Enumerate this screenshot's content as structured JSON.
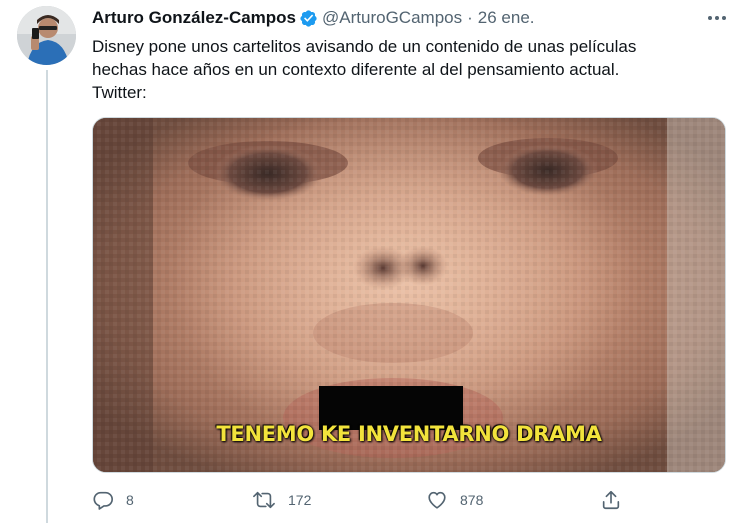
{
  "tweet": {
    "author_name": "Arturo González-Campos",
    "handle": "@ArturoGCampos",
    "separator": "·",
    "date": "26 ene.",
    "verified": true,
    "text_lines": [
      "Disney pone unos cartelitos avisando de un contenido de unas películas",
      "hechas hace años en un contexto diferente al del pensamiento actual.",
      "Twitter:"
    ],
    "media": {
      "caption": "TENEMO KE INVENTARNO DRAMA",
      "caption_color": "#f2e33c"
    },
    "actions": {
      "reply_count": "8",
      "retweet_count": "172",
      "like_count": "878"
    }
  },
  "icons": {
    "verified": "verified-badge-icon",
    "more": "more-horizontal-icon",
    "reply": "reply-icon",
    "retweet": "retweet-icon",
    "like": "heart-icon",
    "share": "share-icon"
  },
  "colors": {
    "accent": "#1d9bf0",
    "secondary_text": "#536471",
    "primary_text": "#0f1419"
  }
}
